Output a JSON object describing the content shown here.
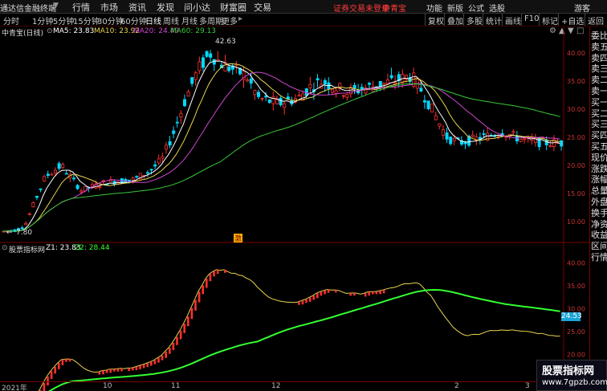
{
  "menubar": {
    "app_name": "通达信金融终端",
    "items": [
      "行情",
      "市场",
      "资讯",
      "发现",
      "问小达",
      "财富圈",
      "交易"
    ],
    "warning": "证券交易未登录",
    "stock_name": "中青宝",
    "right_items": [
      "功能",
      "新版",
      "公式",
      "选股"
    ],
    "guest": "游客"
  },
  "timeframes": [
    "分时",
    "1分钟",
    "5分钟",
    "15分钟",
    "30分钟",
    "60分钟",
    "日线",
    "周线",
    "月线",
    "多周期",
    "更多"
  ],
  "active_timeframe": "日线",
  "toolbar": [
    "复权",
    "叠加",
    "多股",
    "统计",
    "画线",
    "F10",
    "标记",
    "+自选",
    "返回"
  ],
  "main_header": {
    "title": "中青宝(日线)",
    "ma5": "MA5: 23.83",
    "ma10": "MA10: 23.92",
    "ma20": "MA20: 24.49",
    "ma60": "MA60: 29.13"
  },
  "sub_header": {
    "title": "股票指标网",
    "z1": "Z1: 23.83",
    "z2": "Z2: 28.44"
  },
  "right_panel": [
    "委比",
    "卖五",
    "卖四",
    "卖三",
    "卖二",
    "卖一",
    "买一",
    "买二",
    "买三",
    "买四",
    "买五",
    "现价",
    "涨跌",
    "涨幅",
    "总量",
    "外盘",
    "换手",
    "净资",
    "收益",
    "区间",
    "行情"
  ],
  "annotations": {
    "high": "42.63",
    "low": "7.80",
    "alert_badge": "激"
  },
  "main_yaxis": [
    "40.00",
    "35.00",
    "30.00",
    "25.00",
    "20.00",
    "15.00",
    "10.00"
  ],
  "sub_yaxis": [
    "40.00",
    "35.00",
    "30.00",
    "25.00",
    "20.00",
    "15.00"
  ],
  "sub_current_value": "24.53",
  "xaxis": [
    "2021年",
    "10",
    "11",
    "12",
    "2",
    "3"
  ],
  "watermark": {
    "line1": "股票指标网",
    "line2": "www.7gpzb.com"
  },
  "colors": {
    "up": "#ff3030",
    "down": "#00d8ff",
    "ma5": "#ffffff",
    "ma10": "#e8d44d",
    "ma20": "#d046d0",
    "ma60": "#38c838",
    "z2": "#33ff33"
  }
}
